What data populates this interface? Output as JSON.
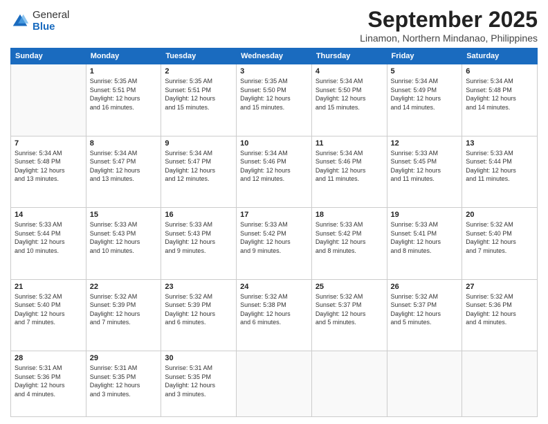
{
  "logo": {
    "general": "General",
    "blue": "Blue"
  },
  "header": {
    "month": "September 2025",
    "location": "Linamon, Northern Mindanao, Philippines"
  },
  "weekdays": [
    "Sunday",
    "Monday",
    "Tuesday",
    "Wednesday",
    "Thursday",
    "Friday",
    "Saturday"
  ],
  "weeks": [
    [
      {
        "day": "",
        "sunrise": "",
        "sunset": "",
        "daylight": ""
      },
      {
        "day": "1",
        "sunrise": "Sunrise: 5:35 AM",
        "sunset": "Sunset: 5:51 PM",
        "daylight": "Daylight: 12 hours and 16 minutes."
      },
      {
        "day": "2",
        "sunrise": "Sunrise: 5:35 AM",
        "sunset": "Sunset: 5:51 PM",
        "daylight": "Daylight: 12 hours and 15 minutes."
      },
      {
        "day": "3",
        "sunrise": "Sunrise: 5:35 AM",
        "sunset": "Sunset: 5:50 PM",
        "daylight": "Daylight: 12 hours and 15 minutes."
      },
      {
        "day": "4",
        "sunrise": "Sunrise: 5:34 AM",
        "sunset": "Sunset: 5:50 PM",
        "daylight": "Daylight: 12 hours and 15 minutes."
      },
      {
        "day": "5",
        "sunrise": "Sunrise: 5:34 AM",
        "sunset": "Sunset: 5:49 PM",
        "daylight": "Daylight: 12 hours and 14 minutes."
      },
      {
        "day": "6",
        "sunrise": "Sunrise: 5:34 AM",
        "sunset": "Sunset: 5:48 PM",
        "daylight": "Daylight: 12 hours and 14 minutes."
      }
    ],
    [
      {
        "day": "7",
        "sunrise": "Sunrise: 5:34 AM",
        "sunset": "Sunset: 5:48 PM",
        "daylight": "Daylight: 12 hours and 13 minutes."
      },
      {
        "day": "8",
        "sunrise": "Sunrise: 5:34 AM",
        "sunset": "Sunset: 5:47 PM",
        "daylight": "Daylight: 12 hours and 13 minutes."
      },
      {
        "day": "9",
        "sunrise": "Sunrise: 5:34 AM",
        "sunset": "Sunset: 5:47 PM",
        "daylight": "Daylight: 12 hours and 12 minutes."
      },
      {
        "day": "10",
        "sunrise": "Sunrise: 5:34 AM",
        "sunset": "Sunset: 5:46 PM",
        "daylight": "Daylight: 12 hours and 12 minutes."
      },
      {
        "day": "11",
        "sunrise": "Sunrise: 5:34 AM",
        "sunset": "Sunset: 5:46 PM",
        "daylight": "Daylight: 12 hours and 11 minutes."
      },
      {
        "day": "12",
        "sunrise": "Sunrise: 5:33 AM",
        "sunset": "Sunset: 5:45 PM",
        "daylight": "Daylight: 12 hours and 11 minutes."
      },
      {
        "day": "13",
        "sunrise": "Sunrise: 5:33 AM",
        "sunset": "Sunset: 5:44 PM",
        "daylight": "Daylight: 12 hours and 11 minutes."
      }
    ],
    [
      {
        "day": "14",
        "sunrise": "Sunrise: 5:33 AM",
        "sunset": "Sunset: 5:44 PM",
        "daylight": "Daylight: 12 hours and 10 minutes."
      },
      {
        "day": "15",
        "sunrise": "Sunrise: 5:33 AM",
        "sunset": "Sunset: 5:43 PM",
        "daylight": "Daylight: 12 hours and 10 minutes."
      },
      {
        "day": "16",
        "sunrise": "Sunrise: 5:33 AM",
        "sunset": "Sunset: 5:43 PM",
        "daylight": "Daylight: 12 hours and 9 minutes."
      },
      {
        "day": "17",
        "sunrise": "Sunrise: 5:33 AM",
        "sunset": "Sunset: 5:42 PM",
        "daylight": "Daylight: 12 hours and 9 minutes."
      },
      {
        "day": "18",
        "sunrise": "Sunrise: 5:33 AM",
        "sunset": "Sunset: 5:42 PM",
        "daylight": "Daylight: 12 hours and 8 minutes."
      },
      {
        "day": "19",
        "sunrise": "Sunrise: 5:33 AM",
        "sunset": "Sunset: 5:41 PM",
        "daylight": "Daylight: 12 hours and 8 minutes."
      },
      {
        "day": "20",
        "sunrise": "Sunrise: 5:32 AM",
        "sunset": "Sunset: 5:40 PM",
        "daylight": "Daylight: 12 hours and 7 minutes."
      }
    ],
    [
      {
        "day": "21",
        "sunrise": "Sunrise: 5:32 AM",
        "sunset": "Sunset: 5:40 PM",
        "daylight": "Daylight: 12 hours and 7 minutes."
      },
      {
        "day": "22",
        "sunrise": "Sunrise: 5:32 AM",
        "sunset": "Sunset: 5:39 PM",
        "daylight": "Daylight: 12 hours and 7 minutes."
      },
      {
        "day": "23",
        "sunrise": "Sunrise: 5:32 AM",
        "sunset": "Sunset: 5:39 PM",
        "daylight": "Daylight: 12 hours and 6 minutes."
      },
      {
        "day": "24",
        "sunrise": "Sunrise: 5:32 AM",
        "sunset": "Sunset: 5:38 PM",
        "daylight": "Daylight: 12 hours and 6 minutes."
      },
      {
        "day": "25",
        "sunrise": "Sunrise: 5:32 AM",
        "sunset": "Sunset: 5:37 PM",
        "daylight": "Daylight: 12 hours and 5 minutes."
      },
      {
        "day": "26",
        "sunrise": "Sunrise: 5:32 AM",
        "sunset": "Sunset: 5:37 PM",
        "daylight": "Daylight: 12 hours and 5 minutes."
      },
      {
        "day": "27",
        "sunrise": "Sunrise: 5:32 AM",
        "sunset": "Sunset: 5:36 PM",
        "daylight": "Daylight: 12 hours and 4 minutes."
      }
    ],
    [
      {
        "day": "28",
        "sunrise": "Sunrise: 5:31 AM",
        "sunset": "Sunset: 5:36 PM",
        "daylight": "Daylight: 12 hours and 4 minutes."
      },
      {
        "day": "29",
        "sunrise": "Sunrise: 5:31 AM",
        "sunset": "Sunset: 5:35 PM",
        "daylight": "Daylight: 12 hours and 3 minutes."
      },
      {
        "day": "30",
        "sunrise": "Sunrise: 5:31 AM",
        "sunset": "Sunset: 5:35 PM",
        "daylight": "Daylight: 12 hours and 3 minutes."
      },
      {
        "day": "",
        "sunrise": "",
        "sunset": "",
        "daylight": ""
      },
      {
        "day": "",
        "sunrise": "",
        "sunset": "",
        "daylight": ""
      },
      {
        "day": "",
        "sunrise": "",
        "sunset": "",
        "daylight": ""
      },
      {
        "day": "",
        "sunrise": "",
        "sunset": "",
        "daylight": ""
      }
    ]
  ]
}
